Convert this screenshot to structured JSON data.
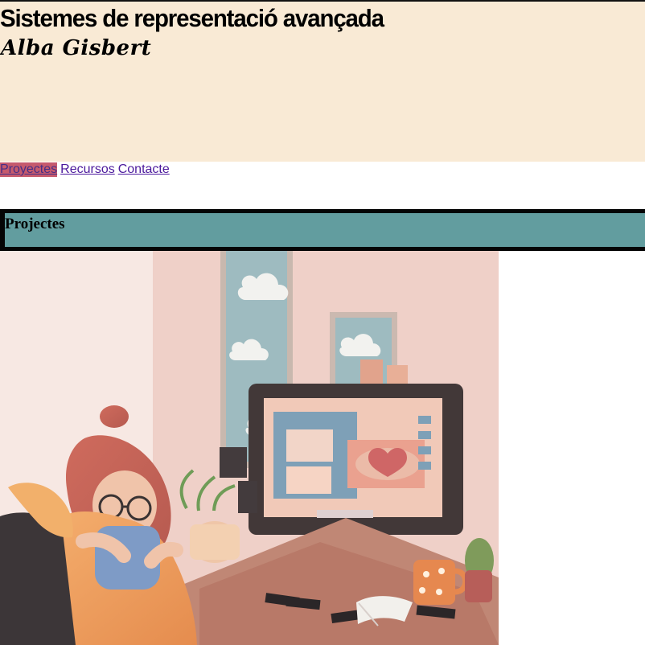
{
  "header": {
    "title": "Sistemes de representació avançada",
    "author": "Alba Gisbert"
  },
  "nav": {
    "items": [
      {
        "label": "Proyectes"
      },
      {
        "label": "Recursos"
      },
      {
        "label": "Contacte"
      }
    ]
  },
  "section": {
    "title": "Projectes"
  },
  "colors": {
    "header_bg": "#f9ead5",
    "nav_active_bg": "#c65a6d",
    "link": "#4c1a9d",
    "section_bg": "#629d9f",
    "section_border": "#050505"
  },
  "image": {
    "subject": "illustration-woman-at-computer"
  }
}
